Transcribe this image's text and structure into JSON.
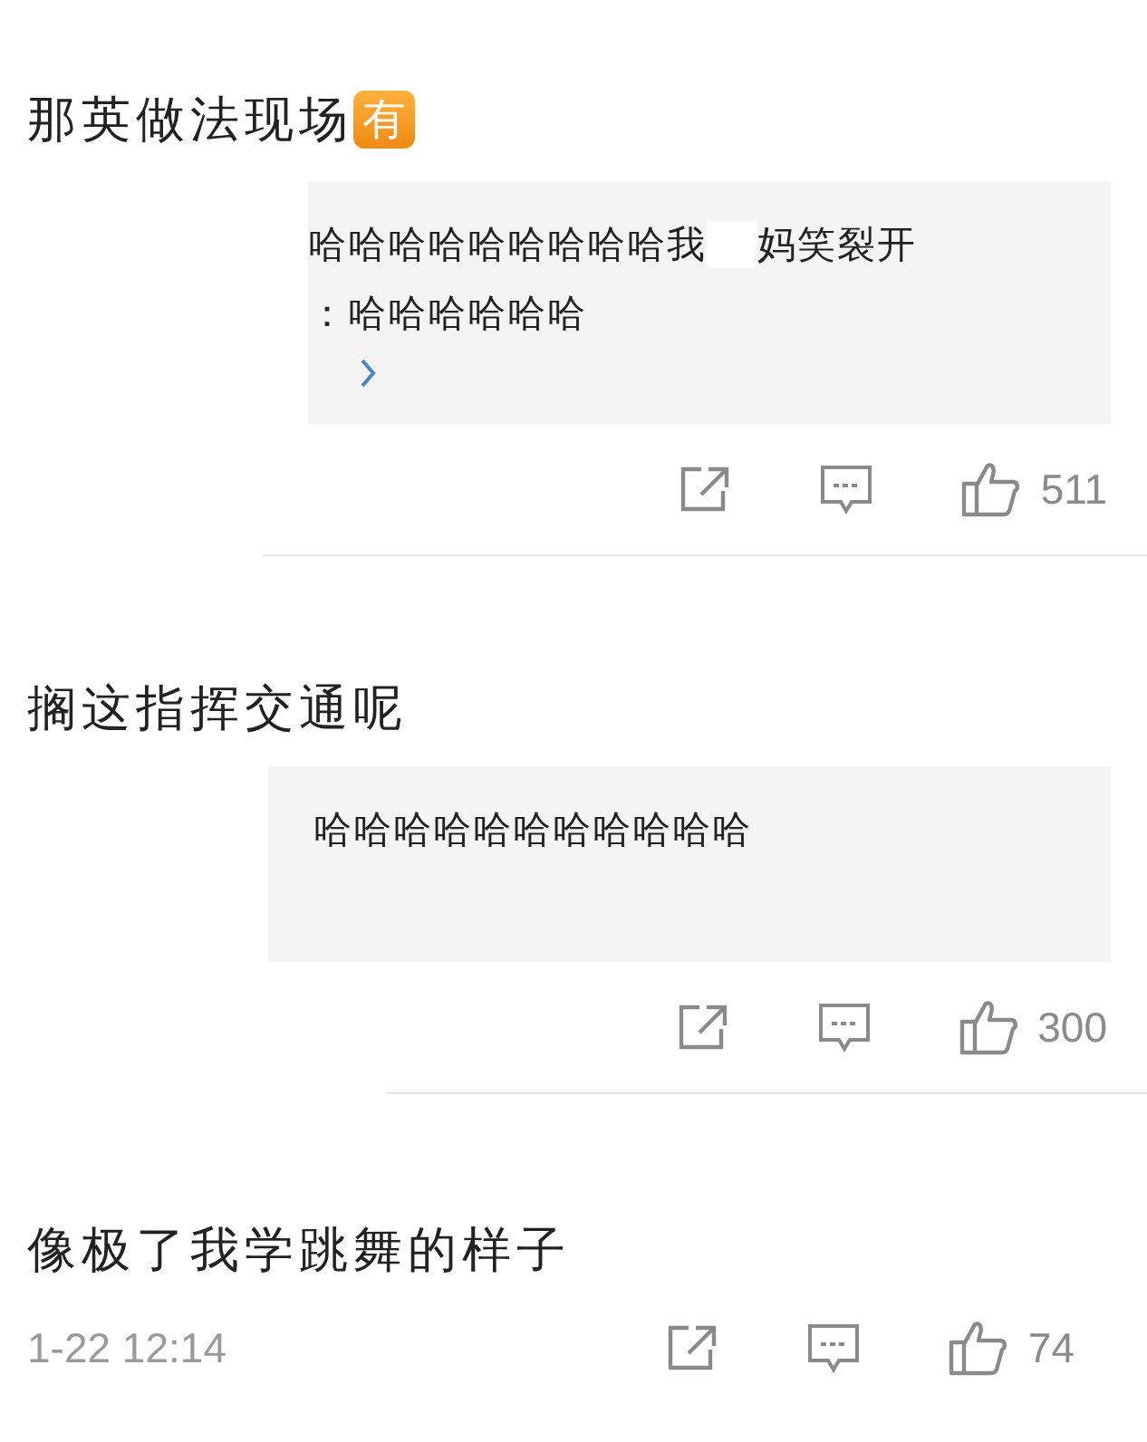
{
  "comments": [
    {
      "text": "那英做法现场",
      "badge": "有",
      "quote": {
        "lines": [
          [
            {
              "kind": "text",
              "text": "哈哈哈哈哈哈哈哈哈我"
            },
            {
              "kind": "redacted"
            },
            {
              "kind": "text",
              "text": "妈笑裂开"
            }
          ],
          [
            {
              "kind": "text",
              "text": "：哈哈哈哈哈哈"
            }
          ]
        ],
        "has_more": true
      },
      "likes": "511"
    },
    {
      "text": "搁这指挥交通呢",
      "quote": {
        "lines": [
          [
            {
              "kind": "text",
              "text": "哈哈哈哈哈哈哈哈哈哈哈"
            }
          ]
        ],
        "has_more": false
      },
      "likes": "300"
    },
    {
      "text": "像极了我学跳舞的样子",
      "timestamp": "1-22 12:14",
      "likes": "74"
    }
  ]
}
